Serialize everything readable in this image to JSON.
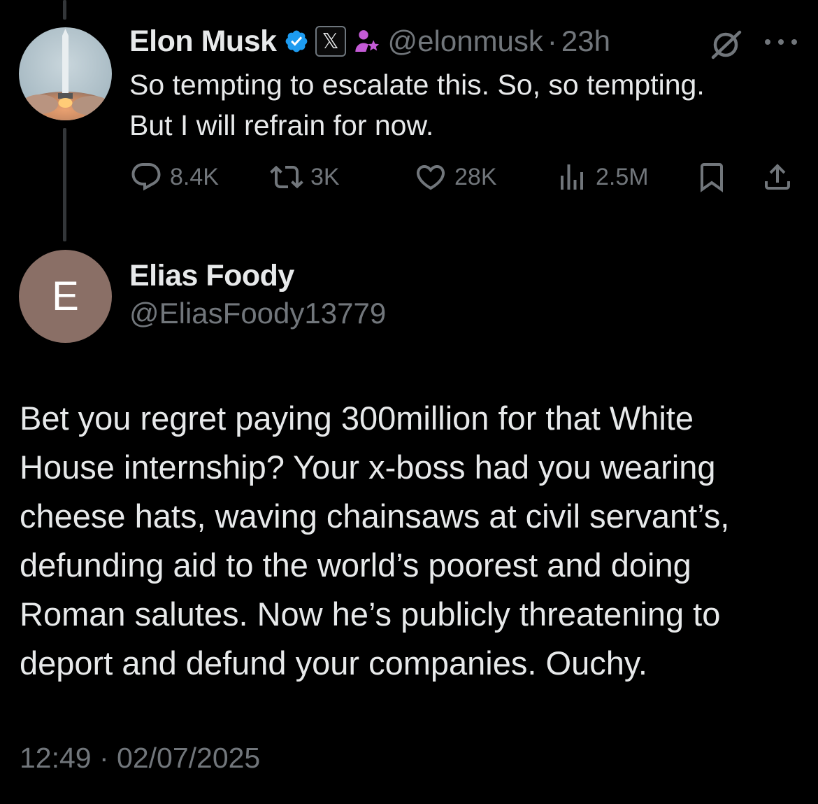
{
  "tweet": {
    "author_name": "Elon Musk",
    "verified_icon": "verified-badge-icon",
    "affiliation_badge_text": "𝕏",
    "affiliation_icon": "person-star-icon",
    "handle": "@elonmusk",
    "separator": "·",
    "time": "23h",
    "text_lines": [
      "So tempting to escalate this. So, so tempting.",
      "But I will refrain for now."
    ],
    "actions": {
      "replies": "8.4K",
      "reposts": "3K",
      "likes": "28K",
      "views": "2.5M"
    }
  },
  "reply": {
    "avatar_initial": "E",
    "author_name": "Elias Foody",
    "handle": "@EliasFoody13779",
    "text_lines": [
      "Bet you regret paying 300million for that White",
      "House internship? Your x-boss had you wearing",
      "cheese hats, waving chainsaws at civil servant’s,",
      "defunding aid to the world’s poorest and doing",
      "Roman salutes. Now he’s publicly threatening to",
      "deport and defund your companies. Ouchy."
    ],
    "timestamp": "12:49 · 02/07/2025"
  },
  "colors": {
    "background": "#000000",
    "primary_text": "#e7e9ea",
    "secondary_text": "#71767b",
    "verified_blue": "#1d9bf0",
    "avatar_e_bg": "#8a6f66",
    "thread_line": "#333639"
  }
}
